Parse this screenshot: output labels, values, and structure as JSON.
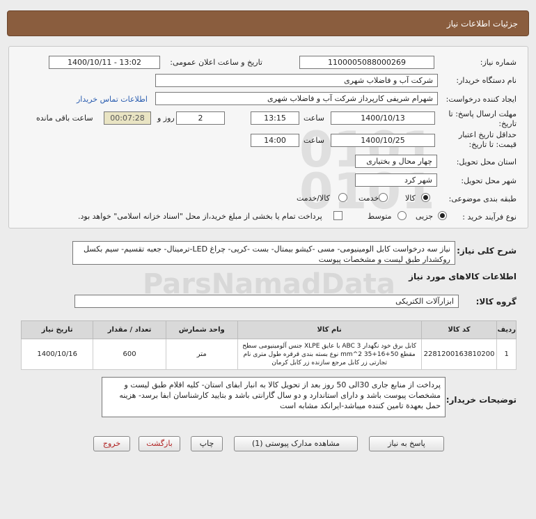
{
  "header": {
    "title": "جزئیات اطلاعات نیاز"
  },
  "form": {
    "need_number": {
      "label": "شماره نیاز:",
      "value": "1100005088000269"
    },
    "announce_datetime": {
      "label": "تاریخ و ساعت اعلان عمومی:",
      "value": "1400/10/11 - 13:02"
    },
    "buyer_org": {
      "label": "نام دستگاه خریدار:",
      "value": "شرکت آب و فاضلاب شهری"
    },
    "requester": {
      "label": "ایجاد کننده درخواست:",
      "value": "شهرام  شریفی  کارپرداز  شرکت آب و فاضلاب شهری",
      "contact_link": "اطلاعات تماس خریدار"
    },
    "response_deadline": {
      "label": "مهلت ارسال پاسخ: تا تاریخ:",
      "date": "1400/10/13",
      "time_label": "ساعت",
      "time": "13:15",
      "days": "2",
      "days_label": "روز و",
      "remaining": "00:07:28",
      "remaining_label": "ساعت باقی مانده"
    },
    "price_validity": {
      "label": "حداقل تاریخ اعتبار قیمت: تا تاریخ:",
      "date": "1400/10/25",
      "time_label": "ساعت",
      "time": "14:00"
    },
    "delivery_province": {
      "label": "استان محل تحویل:",
      "value": "چهار محال و بختیاری"
    },
    "delivery_city": {
      "label": "شهر محل تحویل:",
      "value": "شهر کرد"
    },
    "category": {
      "label": "طبقه بندی موضوعی:",
      "options": [
        "کالا",
        "خدمت",
        "کالا/خدمت"
      ],
      "selected": "کالا"
    },
    "purchase_type": {
      "label": "نوع فرآیند خرید :",
      "options": [
        "جزیی",
        "متوسط"
      ],
      "selected": "جزیی",
      "payment_note": "پرداخت تمام یا بخشی از مبلغ خرید،از محل \"اسناد خزانه اسلامی\" خواهد بود."
    }
  },
  "description": {
    "label": "شرح کلی نیاز:",
    "text": "نیاز سه درخواست کابل الومینیومی- مسی -کیشو بیمتال- بست -کرپی- چراغ LED-ترمینال- جعبه تقسیم- سیم بکسل روکشدار طبق لیست و مشخصات پیوست"
  },
  "goods_section": {
    "title": "اطلاعات کالاهای مورد نیاز"
  },
  "goods_group": {
    "label": "گروه کالا:",
    "value": "ابزارآلات الکتریکی"
  },
  "table": {
    "headers": [
      "ردیف",
      "کد کالا",
      "نام کالا",
      "واحد شمارش",
      "تعداد / مقدار",
      "تاریخ نیاز"
    ],
    "rows": [
      {
        "index": "1",
        "code": "2281200163810200",
        "name": "کابل برق خود نگهدار ABC 3 با عایق XLPE جنس آلومینیومی سطح مقطع 50+16+35 mm^2 نوع بسته بندی قرقره طول متری نام تجارتی زر کابل مرجع سازنده زر کابل کرمان",
        "unit": "متر",
        "quantity": "600",
        "date": "1400/10/16"
      }
    ]
  },
  "buyer_notes": {
    "label": "توضیحات خریدار:",
    "text": "پرداخت از منابع جاری 30الی 50 روز بعد از تحویل کالا به انبار ابفای استان- کلیه اقلام طبق لیست و مشخصات پیوست باشد و دارای استاندارد و دو سال گارانتی باشد و بتایید کارشناسان ابفا برسد- هزینه حمل بعهدة تامین کننده میباشد-ایرانکد مشابه است"
  },
  "buttons": {
    "reply": "پاسخ به نیاز",
    "attachments": "مشاهده مدارک پیوستی (1)",
    "print": "چاپ",
    "back": "بازگشت",
    "exit": "خروج"
  }
}
